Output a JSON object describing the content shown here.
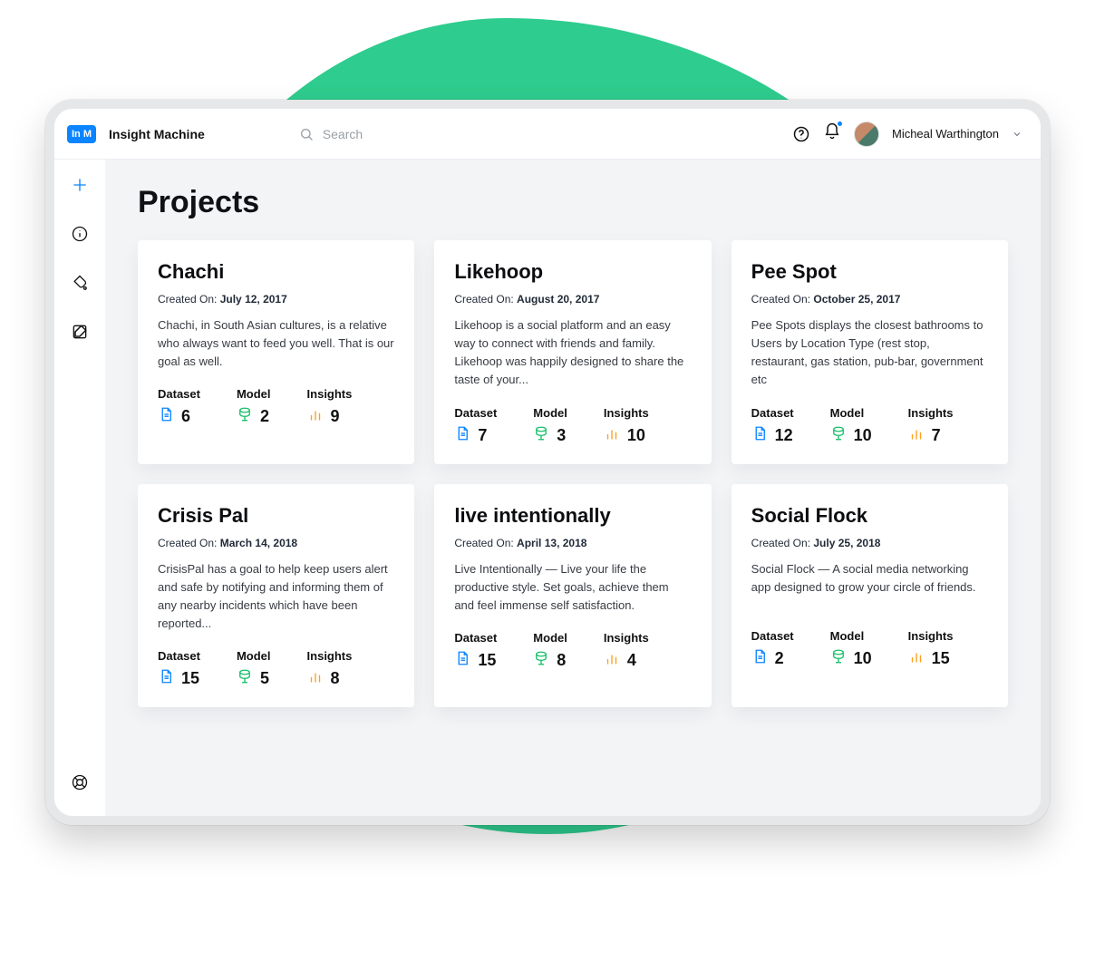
{
  "brand": {
    "badge": "In M",
    "name": "Insight Machine"
  },
  "search": {
    "placeholder": "Search",
    "value": ""
  },
  "user": {
    "name": "Micheal Warthington"
  },
  "page": {
    "title": "Projects",
    "createdLabel": "Created On:"
  },
  "stats": {
    "datasetLabel": "Dataset",
    "modelLabel": "Model",
    "insightsLabel": "Insights"
  },
  "projects": [
    {
      "title": "Chachi",
      "created": "July 12, 2017",
      "desc": "Chachi, in South Asian cultures, is a relative who always want to feed you well. That is our goal as well.",
      "dataset": "6",
      "model": "2",
      "insights": "9"
    },
    {
      "title": "Likehoop",
      "created": "August 20, 2017",
      "desc": "Likehoop is a social platform and an easy way to connect with friends and family. Likehoop was happily designed to share the taste of your...",
      "dataset": "7",
      "model": "3",
      "insights": "10"
    },
    {
      "title": "Pee Spot",
      "created": "October 25, 2017",
      "desc": "Pee Spots displays the closest bathrooms to Users by Location Type (rest stop, restaurant, gas station, pub-bar, government etc",
      "dataset": "12",
      "model": "10",
      "insights": "7"
    },
    {
      "title": "Crisis Pal",
      "created": "March 14, 2018",
      "desc": "CrisisPal has a goal to help keep users alert and safe by notifying and informing them of any nearby incidents which have been reported...",
      "dataset": "15",
      "model": "5",
      "insights": "8"
    },
    {
      "title": "live intentionally",
      "created": "April 13, 2018",
      "desc": "Live Intentionally — Live your life the productive style. Set goals, achieve them and feel immense self satisfaction.",
      "dataset": "15",
      "model": "8",
      "insights": "4"
    },
    {
      "title": "Social Flock",
      "created": "July 25, 2018",
      "desc": "Social Flock — A social media networking app designed to grow your circle of friends.",
      "dataset": "2",
      "model": "10",
      "insights": "15"
    }
  ]
}
